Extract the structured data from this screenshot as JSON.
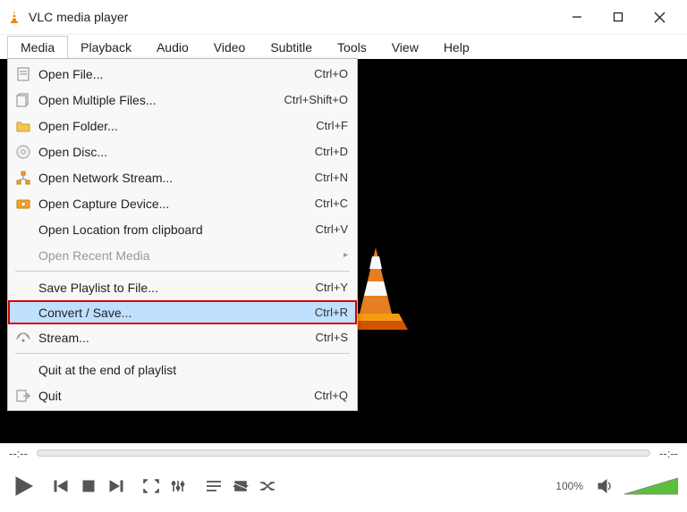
{
  "window": {
    "title": "VLC media player"
  },
  "menubar": [
    "Media",
    "Playback",
    "Audio",
    "Video",
    "Subtitle",
    "Tools",
    "View",
    "Help"
  ],
  "dropdown": {
    "groups": [
      [
        {
          "icon": "file",
          "label": "Open File...",
          "shortcut": "Ctrl+O"
        },
        {
          "icon": "files",
          "label": "Open Multiple Files...",
          "shortcut": "Ctrl+Shift+O"
        },
        {
          "icon": "folder",
          "label": "Open Folder...",
          "shortcut": "Ctrl+F"
        },
        {
          "icon": "disc",
          "label": "Open Disc...",
          "shortcut": "Ctrl+D"
        },
        {
          "icon": "network",
          "label": "Open Network Stream...",
          "shortcut": "Ctrl+N"
        },
        {
          "icon": "capture",
          "label": "Open Capture Device...",
          "shortcut": "Ctrl+C"
        },
        {
          "icon": "",
          "label": "Open Location from clipboard",
          "shortcut": "Ctrl+V"
        },
        {
          "icon": "",
          "label": "Open Recent Media",
          "shortcut": "",
          "disabled": true,
          "submenu": true
        }
      ],
      [
        {
          "icon": "",
          "label": "Save Playlist to File...",
          "shortcut": "Ctrl+Y"
        },
        {
          "icon": "",
          "label": "Convert / Save...",
          "shortcut": "Ctrl+R",
          "highlight": true
        },
        {
          "icon": "stream",
          "label": "Stream...",
          "shortcut": "Ctrl+S"
        }
      ],
      [
        {
          "icon": "",
          "label": "Quit at the end of playlist",
          "shortcut": ""
        },
        {
          "icon": "quit",
          "label": "Quit",
          "shortcut": "Ctrl+Q"
        }
      ]
    ]
  },
  "timeline": {
    "left": "--:--",
    "right": "--:--"
  },
  "volume": {
    "text": "100%"
  }
}
